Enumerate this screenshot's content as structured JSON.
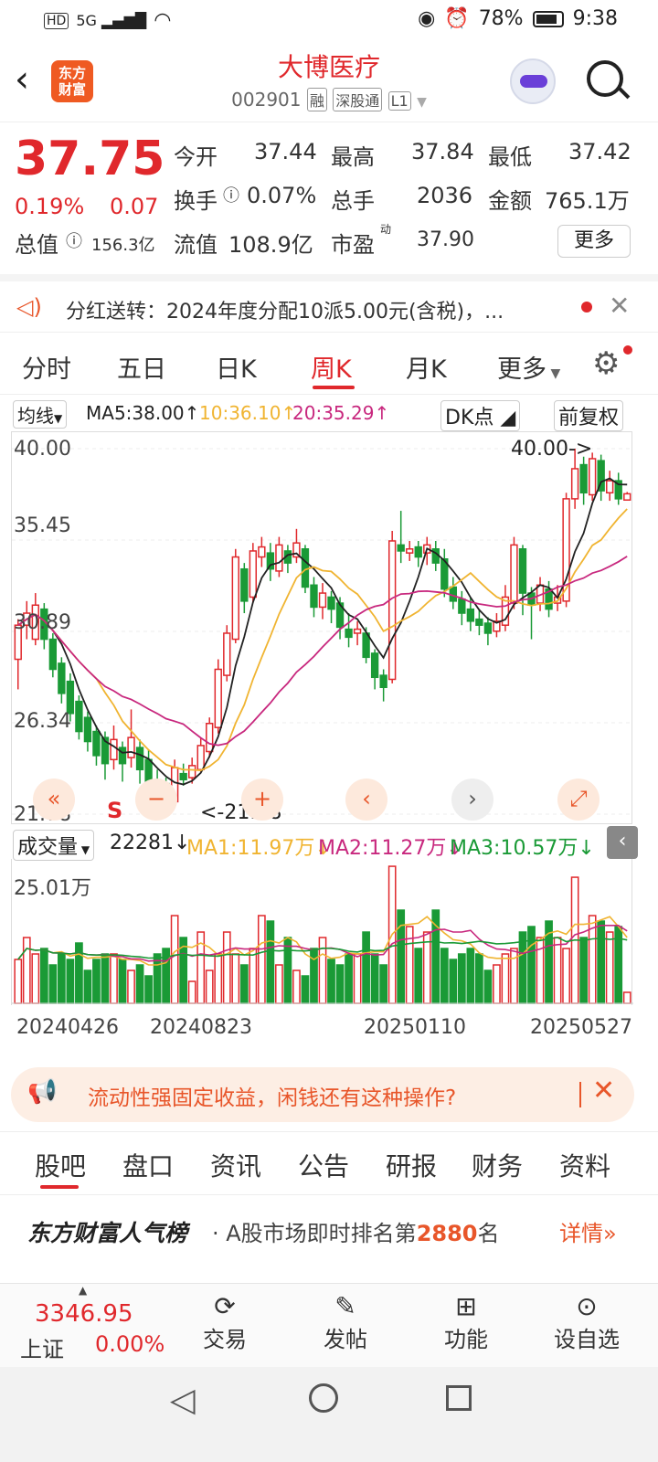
{
  "status": {
    "left": "HD 5G",
    "battery": "78%",
    "time": "9:38"
  },
  "header": {
    "title": "大博医疗",
    "code": "002901",
    "tags": [
      "融",
      "深股通",
      "L1"
    ],
    "logo": "东方财富"
  },
  "quote": {
    "price": "37.75",
    "pct": "0.19%",
    "chg": "0.07",
    "open_label": "今开",
    "open": "37.44",
    "high_label": "最高",
    "high": "37.84",
    "low_label": "最低",
    "low": "37.42",
    "turnover_label": "换手",
    "turnover": "0.07%",
    "vol_label": "总手",
    "vol": "2036",
    "amount_label": "金额",
    "amount": "765.1万",
    "mktcap_label": "总值",
    "mktcap": "156.3亿",
    "float_label": "流值",
    "float": "108.9亿",
    "pe_label": "市盈",
    "pe_sup": "动",
    "pe": "37.90",
    "more": "更多"
  },
  "notice": {
    "text": "分红送转：2024年度分配10派5.00元(含税)，..."
  },
  "tabs": [
    "分时",
    "五日",
    "日K",
    "周K",
    "月K",
    "更多"
  ],
  "ma_legend": {
    "selector": "均线",
    "ma5": "MA5:38.00↑",
    "ma10": "10:36.10↑",
    "ma20": "20:35.29↑",
    "dk": "DK点",
    "adj": "前复权"
  },
  "colors": {
    "up": "#e0282c",
    "down": "#1a9a36",
    "ma5": "#222222",
    "ma10": "#f0b431",
    "ma20": "#c8287e"
  },
  "chart_data": {
    "type": "candlestick",
    "y_ticks": [
      "40.00",
      "35.45",
      "30.89",
      "26.34",
      "21.78"
    ],
    "ylim": [
      21.78,
      40.0
    ],
    "max_label": "40.00->",
    "min_label": "<-21.78",
    "signal": "S",
    "candles": [
      [
        29.5,
        31.2,
        28.0,
        31.5
      ],
      [
        31.2,
        31.8,
        30.5,
        32.4
      ],
      [
        30.5,
        32.2,
        30.2,
        32.8
      ],
      [
        32.0,
        30.5,
        30.0,
        32.3
      ],
      [
        30.5,
        29.0,
        28.6,
        30.8
      ],
      [
        29.3,
        27.8,
        27.3,
        29.6
      ],
      [
        28.4,
        26.8,
        26.4,
        28.8
      ],
      [
        27.4,
        25.9,
        25.5,
        27.7
      ],
      [
        26.6,
        25.4,
        24.9,
        26.9
      ],
      [
        25.9,
        24.7,
        24.2,
        26.2
      ],
      [
        25.6,
        24.3,
        23.5,
        25.9
      ],
      [
        24.5,
        25.5,
        24.0,
        26.2
      ],
      [
        25.1,
        24.3,
        23.4,
        25.4
      ],
      [
        24.6,
        25.6,
        24.1,
        27.0
      ],
      [
        25.1,
        24.0,
        23.3,
        25.5
      ],
      [
        24.5,
        23.3,
        22.8,
        25.0
      ],
      [
        23.5,
        23.2,
        21.9,
        24.0
      ],
      [
        23.3,
        22.2,
        21.78,
        23.6
      ],
      [
        22.4,
        24.1,
        22.1,
        24.5
      ],
      [
        23.8,
        23.5,
        23.2,
        24.3
      ],
      [
        23.6,
        24.2,
        23.3,
        24.6
      ],
      [
        24.0,
        25.2,
        23.9,
        25.6
      ],
      [
        24.9,
        26.3,
        24.6,
        26.6
      ],
      [
        26.1,
        29.0,
        25.8,
        29.5
      ],
      [
        28.7,
        30.8,
        28.4,
        31.2
      ],
      [
        30.5,
        34.6,
        30.3,
        35.0
      ],
      [
        34.0,
        32.4,
        31.8,
        34.3
      ],
      [
        32.6,
        34.9,
        32.3,
        35.3
      ],
      [
        34.6,
        35.1,
        34.1,
        35.6
      ],
      [
        34.8,
        34.0,
        33.4,
        35.3
      ],
      [
        33.9,
        35.2,
        33.6,
        35.6
      ],
      [
        34.9,
        34.3,
        33.8,
        35.2
      ],
      [
        34.6,
        35.3,
        34.3,
        36.0
      ],
      [
        35.0,
        33.1,
        32.8,
        35.2
      ],
      [
        33.2,
        32.1,
        31.6,
        33.6
      ],
      [
        32.1,
        32.8,
        31.5,
        33.3
      ],
      [
        32.6,
        32.0,
        31.3,
        32.9
      ],
      [
        32.3,
        31.1,
        30.5,
        32.6
      ],
      [
        31.0,
        30.6,
        30.1,
        31.8
      ],
      [
        30.8,
        31.0,
        30.2,
        31.4
      ],
      [
        30.8,
        29.6,
        29.3,
        31.1
      ],
      [
        29.8,
        28.6,
        28.0,
        30.0
      ],
      [
        28.7,
        28.1,
        27.4,
        29.0
      ],
      [
        28.5,
        35.4,
        28.3,
        35.9
      ],
      [
        35.2,
        34.9,
        34.3,
        36.9
      ],
      [
        34.8,
        35.0,
        34.4,
        35.4
      ],
      [
        35.1,
        34.6,
        34.1,
        35.4
      ],
      [
        34.8,
        35.2,
        34.2,
        35.6
      ],
      [
        35.0,
        34.3,
        33.9,
        35.4
      ],
      [
        34.5,
        33.0,
        32.6,
        35.0
      ],
      [
        33.1,
        32.4,
        32.0,
        33.6
      ],
      [
        32.5,
        31.8,
        31.2,
        32.9
      ],
      [
        32.0,
        31.4,
        30.9,
        32.6
      ],
      [
        31.5,
        31.2,
        30.7,
        32.0
      ],
      [
        31.3,
        30.8,
        30.2,
        31.6
      ],
      [
        30.9,
        31.4,
        30.6,
        31.8
      ],
      [
        31.2,
        32.6,
        30.9,
        33.2
      ],
      [
        32.3,
        35.2,
        32.0,
        35.6
      ],
      [
        35.0,
        32.8,
        31.7,
        35.2
      ],
      [
        32.8,
        32.2,
        30.5,
        33.1
      ],
      [
        32.3,
        33.2,
        31.9,
        33.6
      ],
      [
        33.0,
        32.0,
        31.6,
        33.4
      ],
      [
        32.3,
        32.6,
        31.9,
        33.2
      ],
      [
        32.4,
        37.5,
        32.1,
        37.8
      ],
      [
        37.5,
        39.0,
        37.0,
        40.0
      ],
      [
        39.2,
        37.8,
        37.2,
        39.6
      ],
      [
        37.7,
        39.5,
        37.4,
        39.8
      ],
      [
        39.4,
        37.9,
        37.4,
        39.7
      ],
      [
        37.8,
        38.4,
        37.4,
        38.9
      ],
      [
        38.4,
        37.5,
        37.2,
        38.8
      ],
      [
        37.44,
        37.75,
        37.42,
        37.84
      ]
    ]
  },
  "volume": {
    "selector": "成交量",
    "current": "22281↓",
    "ma1": "MA1:11.97万↓",
    "ma2": "MA2:11.27万↓",
    "ma3": "MA3:10.57万↓",
    "max_label": "25.01万",
    "ylim": [
      0,
      25.01
    ],
    "values": [
      8,
      12,
      9,
      10,
      7,
      9,
      8,
      11,
      6,
      8,
      9,
      9,
      8,
      6,
      7,
      5,
      9,
      10,
      16,
      12,
      4,
      13,
      6,
      9,
      13,
      9,
      7,
      10,
      16,
      15,
      7,
      12,
      6,
      5,
      10,
      12,
      8,
      7,
      9,
      9,
      13,
      9,
      7,
      25,
      17,
      14,
      10,
      13,
      17,
      10,
      8,
      9,
      10,
      9,
      6,
      7,
      9,
      10,
      13,
      14,
      12,
      15,
      12,
      10,
      23,
      12,
      16,
      15,
      13,
      14,
      2
    ],
    "dates": [
      "20240426",
      "20240823",
      "20250110",
      "20250527"
    ]
  },
  "banner": {
    "text": "流动性强固定收益，闲钱还有这种操作?"
  },
  "tabs2": [
    "股吧",
    "盘口",
    "资讯",
    "公告",
    "研报",
    "财务",
    "资料"
  ],
  "rank": {
    "brand": "东方财富人气榜",
    "text_pre": "· A股市场即时排名第",
    "num": "2880",
    "text_post": "名",
    "detail": "详情"
  },
  "bottom": {
    "index_value": "3346.95",
    "index_name": "上证",
    "index_pct": "0.00%",
    "items": [
      "交易",
      "发帖",
      "功能",
      "设自选"
    ]
  }
}
